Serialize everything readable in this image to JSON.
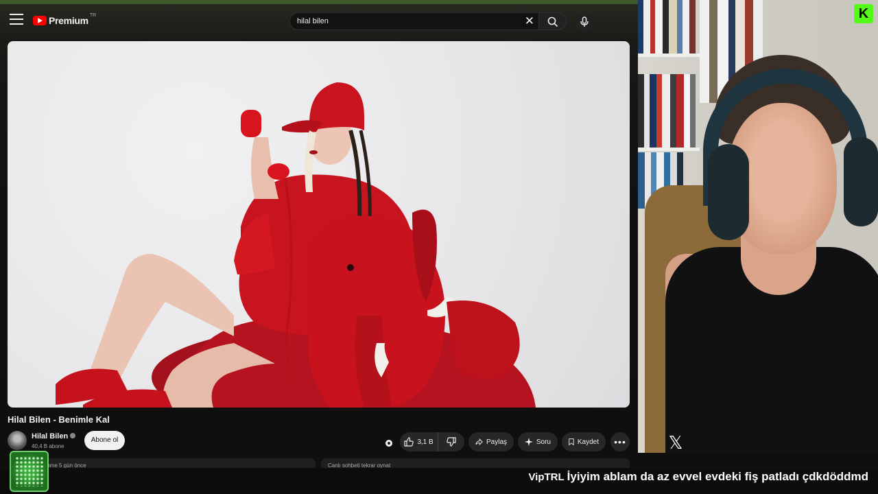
{
  "youtube": {
    "brand": "Premium",
    "country_code": "TR",
    "search": {
      "query": "hilal bilen"
    },
    "video": {
      "title": "Hilal Bilen - Benimle Kal",
      "channel": "Hilal Bilen",
      "subscribers": "40,4 B abone",
      "subscribe_label": "Abone ol",
      "likes": "3,1 B",
      "share_label": "Paylaş",
      "ask_label": "Soru",
      "save_label": "Kaydet"
    },
    "cards": [
      {
        "text": "...ilome  5 gün önce"
      },
      {
        "text": "Canlı sohbeti tekrar oynat"
      }
    ]
  },
  "overlay": {
    "ticker_user": "VipTRL",
    "ticker_message": "İyiyim ablam da az evvel evdeki fiş patladı çdkdöddmd"
  },
  "colors": {
    "youtube_red": "#ff0000",
    "kick_green": "#53fc18"
  },
  "icons": [
    "menu-icon",
    "youtube-logo-icon",
    "clear-icon",
    "search-icon",
    "mic-icon",
    "like-icon",
    "dislike-icon",
    "share-icon",
    "sparkle-icon",
    "bookmark-icon",
    "more-icon",
    "kick-logo-icon",
    "x-logo-icon"
  ]
}
